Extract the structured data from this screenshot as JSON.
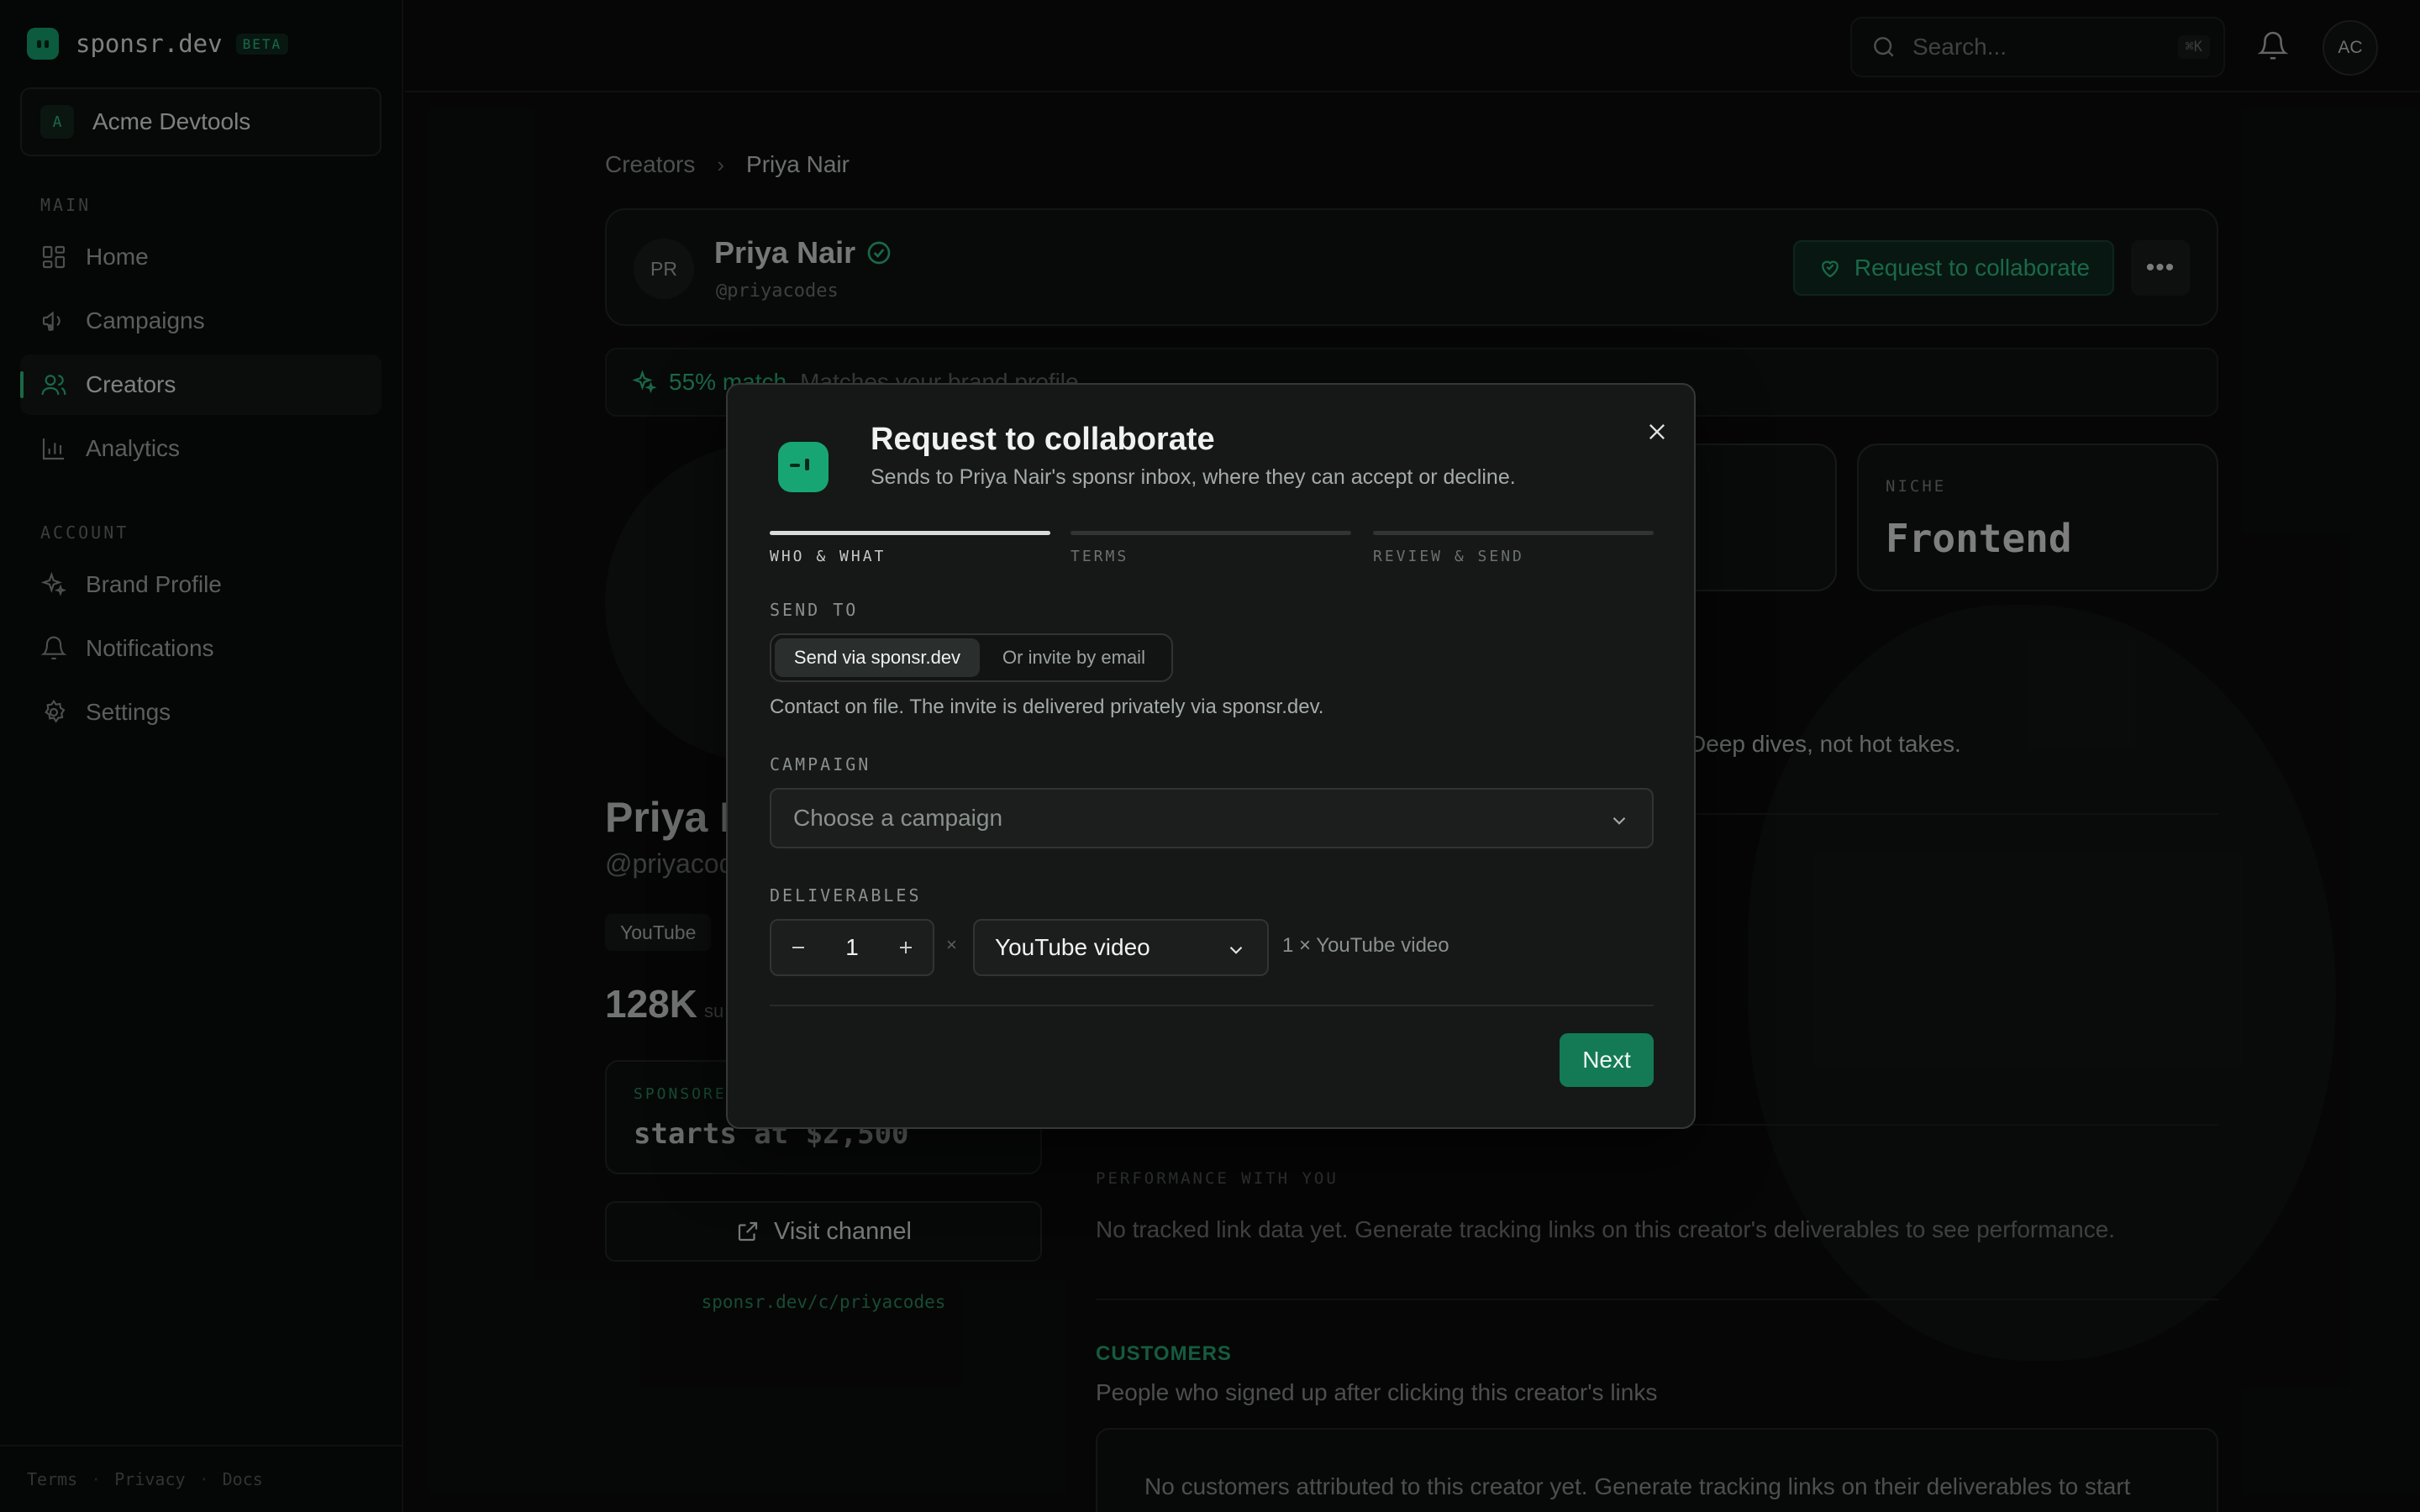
{
  "brand": {
    "name": "sponsr.dev",
    "badge": "BETA"
  },
  "workspace": {
    "initial": "A",
    "name": "Acme Devtools"
  },
  "nav": {
    "main_label": "MAIN",
    "main_items": [
      {
        "label": "Home",
        "icon": "grid-icon"
      },
      {
        "label": "Campaigns",
        "icon": "megaphone-icon"
      },
      {
        "label": "Creators",
        "icon": "users-icon",
        "active": true
      },
      {
        "label": "Analytics",
        "icon": "bar-chart-icon"
      }
    ],
    "account_label": "ACCOUNT",
    "account_items": [
      {
        "label": "Brand Profile",
        "icon": "sparkle-icon"
      },
      {
        "label": "Notifications",
        "icon": "bell-icon"
      },
      {
        "label": "Settings",
        "icon": "gear-icon"
      }
    ]
  },
  "footer": {
    "terms": "Terms",
    "privacy": "Privacy",
    "docs": "Docs"
  },
  "topbar": {
    "search_placeholder": "Search...",
    "shortcut": "⌘K",
    "user_initials": "AC"
  },
  "breadcrumb": {
    "parent": "Creators",
    "current": "Priya Nair"
  },
  "profile": {
    "initials": "PR",
    "name": "Priya Nair",
    "handle": "@priyacodes",
    "collab_label": "Request to collaborate",
    "more_label": "•••",
    "match_pct": "55% match",
    "match_text": "Matches your brand profile",
    "niche_label": "NICHE",
    "niche_value": "Frontend",
    "big_name": "Priya N",
    "big_handle": "@priyacod",
    "platform": "YouTube",
    "subscribers": "128K",
    "subscribers_unit": "su",
    "sponsor_label": "SPONSORE",
    "sponsor_value": "starts at $2,500",
    "visit_label": "Visit channel",
    "channel_link": "sponsr.dev/c/priyacodes",
    "bio_tail": "eers. Deep dives, not hot takes.",
    "performance_label": "PERFORMANCE WITH YOU",
    "performance_text": "No tracked link data yet. Generate tracking links on this creator's deliverables to see performance.",
    "customers_label": "CUSTOMERS",
    "customers_sub": "People who signed up after clicking this creator's links",
    "customers_empty": "No customers attributed to this creator yet. Generate tracking links on their deliverables to start"
  },
  "modal": {
    "title": "Request to collaborate",
    "subtitle": "Sends to Priya Nair's sponsr inbox, where they can accept or decline.",
    "steps": [
      "WHO & WHAT",
      "TERMS",
      "REVIEW & SEND"
    ],
    "active_step": 0,
    "send_to_label": "SEND TO",
    "send_options": [
      "Send via sponsr.dev",
      "Or invite by email"
    ],
    "send_help": "Contact on file. The invite is delivered privately via sponsr.dev.",
    "campaign_label": "CAMPAIGN",
    "campaign_placeholder": "Choose a campaign",
    "deliverables_label": "DELIVERABLES",
    "quantity": "1",
    "times": "×",
    "deliverable_type": "YouTube video",
    "deliverable_summary": "1 × YouTube video",
    "next_label": "Next"
  },
  "colors": {
    "accent": "#2fbf85",
    "accent_dark": "#137a55",
    "background": "#0b0c0c"
  }
}
